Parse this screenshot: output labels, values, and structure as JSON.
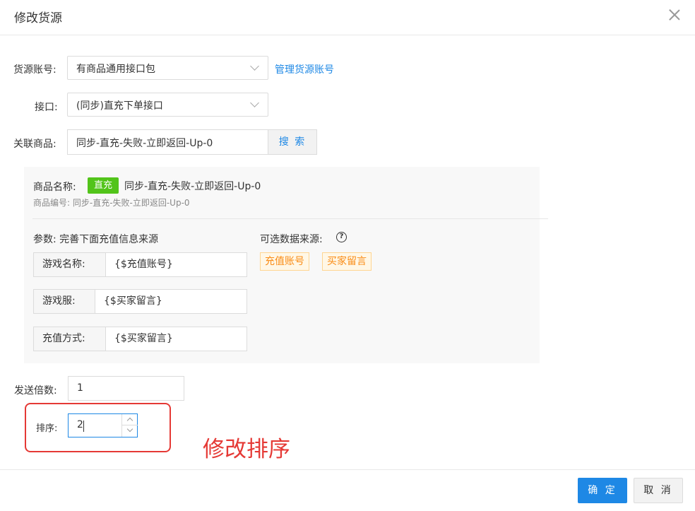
{
  "dialog": {
    "title": "修改货源"
  },
  "form": {
    "source_account": {
      "label": "货源账号:",
      "value": "有商品通用接口包",
      "manage_link": "管理货源账号"
    },
    "interface": {
      "label": "接口:",
      "value": "(同步)直充下单接口"
    },
    "linked_product": {
      "label": "关联商品:",
      "value": "同步-直充-失败-立即返回-Up-0",
      "search_button": "搜 索"
    },
    "product_panel": {
      "name_label": "商品名称:",
      "badge": "直充",
      "name": "同步-直充-失败-立即返回-Up-0",
      "code_line": "商品编号: 同步-直充-失败-立即返回-Up-0",
      "params_label": "参数: 完善下面充值信息来源",
      "sources_label": "可选数据来源:",
      "help_icon": "question-circle-icon",
      "params": [
        {
          "key": "游戏名称:",
          "value": "{$充值账号}"
        },
        {
          "key": "游戏服:",
          "value": "{$买家留言}"
        },
        {
          "key": "充值方式:",
          "value": "{$买家留言}"
        }
      ],
      "sources": [
        "充值账号",
        "买家留言"
      ]
    },
    "send_multiplier": {
      "label": "发送倍数:",
      "value": "1"
    },
    "sort": {
      "label": "排序:",
      "value": "2"
    }
  },
  "annotation": {
    "text": "修改排序",
    "color": "#e53935"
  },
  "footer": {
    "confirm": "确 定",
    "cancel": "取 消"
  },
  "colors": {
    "primary": "#1e88e5",
    "badge_green": "#52c41a",
    "tag_orange": "#fa8c16"
  }
}
